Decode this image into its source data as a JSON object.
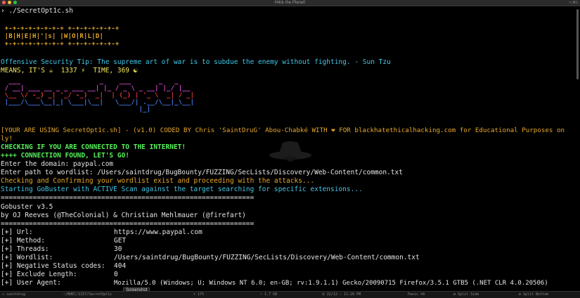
{
  "window": {
    "title": "H4ck the Planet!",
    "shortcut": "⌥⌘1",
    "traffic_colors": [
      "#ff5f57",
      "#febc2e",
      "#28c840"
    ]
  },
  "colors": {
    "fg": "#e6e6e6",
    "orange": "#e5a82a",
    "green_bright": "#56f05a",
    "cyan": "#41c6e8",
    "magenta": "#d64bd4",
    "yellow": "#f2e55a",
    "red": "#e83a3a",
    "blue": "#4b7df0"
  },
  "terminal": {
    "command_line": "› ./SecretOpt1c.sh",
    "banner_box": [
      " +-+-+-+-+-+-+-+ +-+-+-+-+-+-+",
      " |B|H|E|H|'|s| |W|O|R|L|D|",
      " +-+-+-+-+-+-+-+ +-+-+-+-+-+-+"
    ],
    "tip": "Offensive Security Tip: The supreme art of war is to subdue the enemy without fighting. - Sun Tzu",
    "means": "MEANS, IT'S ☕  1337 ⚡  TIME, 369 ☯",
    "logo_art": [
      "  ___                    _    ___       _   _      ",
      " / __| ___ __ _ _ ___ __| |_ / _ \\ _ __| |_/ |__   ",
      " \\__ \\/ -_) _| '_/ -_)  _|  | (_) | '_ \\  _| / _|  ",
      " |___/\\___\\__|_| \\___|\\__|   \\___/| .__/\\__|_\\__|  ",
      "                                   |_|             "
    ],
    "using_line": "[YOUR ARE USING SecretOpt1c.sh] - (v1.0) CODED BY Chris 'SaintDruG' Abou-Chabké WITH ❤ FOR blackhatethicalhacking.com for Educational Purposes on",
    "using_wrap": "ly!",
    "checking_internet": "CHECKING IF YOU ARE CONNECTED TO THE INTERNET!",
    "connection_found": "++++ CONNECTION FOUND, LET'S GO!",
    "enter_domain": "Enter the domain: paypal.com",
    "enter_wordlist": "Enter path to wordlist: /Users/saintdrug/BugBounty/FUZZING/SecLists/Discovery/Web-Content/common.txt",
    "confirming": "Checking and Confirming your wordlist exist and proceeding with the attacks...",
    "starting": "Starting GoBuster with ACTIVE Scan against the target searching for specific extensions...",
    "separator": "===============================================================",
    "gobuster_version": "Gobuster v3.5",
    "gobuster_by": "by OJ Reeves (@TheColonial) & Christian Mehlmauer (@firefart)",
    "options": [
      {
        "key": "[+] Url:",
        "value": "https://www.paypal.com"
      },
      {
        "key": "[+] Method:",
        "value": "GET"
      },
      {
        "key": "[+] Threads:",
        "value": "30"
      },
      {
        "key": "[+] Wordlist:",
        "value": "/Users/saintdrug/BugBounty/FUZZING/SecLists/Discovery/Web-Content/common.txt"
      },
      {
        "key": "[+] Negative Status codes:",
        "value": "404"
      },
      {
        "key": "[+] Exclude Length:",
        "value": "0"
      },
      {
        "key": "[+] User Agent:",
        "value": "Mozilla/5.0 (Windows; U; Windows NT 6.0; en-GB; rv:1.9.1.1) Gecko/20090715 Firefox/3.5.1 GTB5 (.NET CLR 4.0.20506)"
      }
    ]
  },
  "tooltip": "Screenshot",
  "statusbar": {
    "segments": [
      "⌂ saintdrug",
      "~/BHEC/1337/SecretOpt1c",
      "⌥ 17%",
      "⚡ 1.7 GB",
      "⏲ 22/12 — 11:28 PM",
      "Panic ⌘A",
      "⊟ Split Side",
      "⊟ Split Bottom"
    ]
  }
}
